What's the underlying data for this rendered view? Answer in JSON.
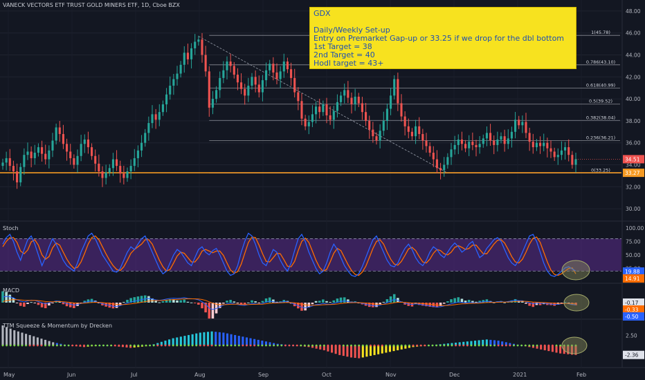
{
  "symbol_title": "VANECK VECTORS ETF TRUST GOLD MINERS ETF, 1D, Cboe BZX",
  "note": {
    "lines": [
      "GDX",
      "",
      "Daily/Weekly Set-up",
      "Entry on Premarket Gap-up or 33.25 if we drop for the dbl bottom",
      "1st Target = 38",
      "2nd Target = 40",
      "Hodl target = 43+"
    ]
  },
  "panels": {
    "stoch_title": "Stoch",
    "macd_title": "MACD",
    "ttm_title": "TTM Squeeze & Momentum by Drecken"
  },
  "colors": {
    "background": "#131722",
    "up": "#26a69a",
    "down": "#ef5350",
    "support_line": "#f59a23",
    "note_bg": "#f7e21f",
    "note_text": "#1d4fb3",
    "stoch_band": "#5b2b8c",
    "stoch_k": "#2962ff",
    "stoch_d": "#ff6d00",
    "fib_line": "#8a8d96"
  },
  "chart_data": [
    {
      "type": "candlestick",
      "title": "VANECK VECTORS ETF TRUST GOLD MINERS ETF, 1D, Cboe BZX",
      "x_labels": [
        "May",
        "Jun",
        "Jul",
        "Aug",
        "Sep",
        "Oct",
        "Nov",
        "Dec",
        "2021",
        "Feb"
      ],
      "y_ticks": [
        30.0,
        32.0,
        34.0,
        36.0,
        38.0,
        40.0,
        42.0,
        44.0,
        46.0,
        48.0
      ],
      "ylim": [
        29,
        49
      ],
      "closes": [
        34.2,
        34.6,
        33.9,
        33.4,
        32.4,
        33.8,
        34.9,
        35.2,
        34.6,
        35.1,
        35.6,
        35.0,
        34.5,
        35.3,
        36.2,
        37.4,
        36.8,
        35.9,
        35.2,
        34.6,
        34.0,
        34.8,
        35.9,
        36.3,
        35.6,
        34.8,
        34.1,
        33.4,
        32.8,
        33.3,
        33.7,
        34.5,
        33.9,
        33.2,
        32.8,
        33.4,
        33.9,
        34.6,
        35.3,
        36.0,
        36.9,
        37.8,
        38.6,
        38.1,
        38.8,
        39.5,
        40.4,
        41.2,
        41.8,
        42.3,
        43.1,
        44.2,
        43.6,
        44.6,
        45.2,
        45.4,
        44.0,
        42.5,
        39.2,
        40.0,
        40.8,
        41.9,
        42.6,
        43.4,
        43.0,
        42.2,
        41.5,
        40.9,
        40.3,
        41.2,
        42.0,
        41.3,
        40.6,
        41.7,
        42.6,
        43.2,
        42.4,
        41.8,
        42.5,
        43.4,
        42.7,
        41.9,
        40.6,
        39.8,
        38.2,
        37.5,
        37.9,
        38.6,
        39.3,
        38.8,
        39.5,
        38.5,
        38.1,
        38.9,
        39.7,
        40.3,
        40.8,
        40.1,
        39.5,
        40.2,
        39.6,
        38.8,
        38.0,
        37.2,
        36.6,
        36.2,
        37.1,
        38.0,
        39.1,
        40.3,
        41.8,
        39.6,
        38.4,
        37.5,
        37.0,
        36.6,
        37.5,
        36.8,
        36.2,
        35.7,
        35.1,
        34.5,
        33.7,
        33.5,
        34.0,
        34.7,
        35.4,
        35.8,
        36.3,
        35.9,
        35.5,
        36.1,
        35.8,
        35.6,
        35.9,
        36.4,
        36.9,
        36.2,
        35.8,
        36.3,
        36.6,
        35.9,
        36.4,
        37.0,
        38.1,
        37.6,
        37.9,
        36.9,
        36.1,
        35.6,
        36.0,
        35.7,
        36.0,
        35.5,
        35.2,
        34.7,
        34.9,
        35.3,
        35.6,
        34.9,
        34.0,
        34.51
      ],
      "support": 33.27,
      "last_price": 34.51,
      "trendline": {
        "from": 45.7,
        "to": 33.25
      },
      "fib_levels": [
        {
          "label": "1(45.78)",
          "value": 45.78
        },
        {
          "label": "0.786(43.10)",
          "value": 43.1
        },
        {
          "label": "0.618(40.99)",
          "value": 40.99
        },
        {
          "label": "0.5(39.52)",
          "value": 39.52
        },
        {
          "label": "0.382(38.04)",
          "value": 38.04
        },
        {
          "label": "0.236(36.21)",
          "value": 36.21
        },
        {
          "label": "0(33.25)",
          "value": 33.25
        }
      ],
      "badges": [
        {
          "label": "34.51",
          "value": 34.51,
          "color": "#ef5350"
        },
        {
          "label": "33.27",
          "value": 33.27,
          "color": "#f59a23"
        }
      ]
    },
    {
      "type": "line",
      "title": "Stoch",
      "y_ticks": [
        25.0,
        50.0,
        75.0,
        100.0
      ],
      "ylim": [
        0,
        110
      ],
      "band": [
        20,
        80
      ],
      "series": [
        {
          "name": "K",
          "values": [
            70,
            82,
            88,
            75,
            55,
            40,
            60,
            78,
            85,
            70,
            50,
            30,
            45,
            65,
            80,
            70,
            55,
            40,
            30,
            25,
            20,
            35,
            55,
            70,
            85,
            90,
            80,
            65,
            50,
            40,
            30,
            20,
            18,
            25,
            40,
            55,
            65,
            60,
            70,
            80,
            85,
            70,
            55,
            40,
            25,
            15,
            20,
            35,
            50,
            60,
            55,
            45,
            35,
            30,
            45,
            60,
            65,
            55,
            50,
            58,
            62,
            50,
            35,
            20,
            12,
            15,
            30,
            55,
            75,
            90,
            85,
            70,
            50,
            35,
            30,
            45,
            60,
            55,
            40,
            28,
            20,
            35,
            58,
            80,
            88,
            75,
            55,
            40,
            25,
            15,
            20,
            35,
            55,
            70,
            60,
            45,
            30,
            20,
            12,
            10,
            15,
            28,
            45,
            62,
            78,
            85,
            70,
            55,
            40,
            30,
            28,
            35,
            50,
            62,
            70,
            60,
            45,
            35,
            30,
            40,
            55,
            65,
            60,
            50,
            45,
            55,
            65,
            72,
            65,
            55,
            60,
            70,
            75,
            60,
            45,
            50,
            62,
            70,
            78,
            82,
            75,
            60,
            45,
            35,
            30,
            40,
            55,
            70,
            85,
            88,
            75,
            55,
            35,
            20,
            12,
            10,
            14,
            20,
            26,
            28,
            24,
            19.88
          ]
        },
        {
          "name": "D",
          "values": [
            65,
            75,
            82,
            82,
            73,
            57,
            52,
            59,
            74,
            78,
            68,
            50,
            42,
            47,
            63,
            72,
            68,
            55,
            42,
            32,
            25,
            27,
            37,
            53,
            70,
            82,
            85,
            78,
            65,
            52,
            40,
            30,
            23,
            21,
            28,
            40,
            53,
            60,
            65,
            70,
            78,
            78,
            70,
            55,
            40,
            28,
            20,
            23,
            35,
            48,
            55,
            53,
            45,
            37,
            37,
            45,
            57,
            60,
            57,
            54,
            57,
            57,
            49,
            35,
            22,
            16,
            19,
            33,
            53,
            73,
            83,
            82,
            68,
            52,
            38,
            37,
            45,
            53,
            52,
            41,
            29,
            28,
            38,
            58,
            75,
            81,
            73,
            57,
            40,
            27,
            20,
            23,
            37,
            53,
            62,
            58,
            45,
            32,
            21,
            14,
            12,
            18,
            29,
            45,
            62,
            75,
            78,
            70,
            55,
            42,
            33,
            31,
            38,
            49,
            61,
            64,
            58,
            47,
            37,
            35,
            42,
            53,
            60,
            58,
            52,
            50,
            55,
            64,
            67,
            64,
            60,
            62,
            68,
            68,
            60,
            52,
            52,
            61,
            70,
            77,
            78,
            72,
            60,
            47,
            37,
            35,
            42,
            55,
            70,
            81,
            83,
            73,
            55,
            37,
            22,
            14,
            12,
            15,
            20,
            25,
            26,
            14.91
          ]
        }
      ],
      "badges": [
        {
          "label": "19.88",
          "value": 19.88,
          "color": "#2962ff"
        },
        {
          "label": "14.91",
          "value": 14.91,
          "color": "#ff6d00"
        }
      ]
    },
    {
      "type": "bar",
      "title": "MACD",
      "ylim": [
        -1.2,
        1.2
      ],
      "values": [
        0.4,
        0.45,
        0.42,
        0.35,
        0.2,
        0.1,
        0.05,
        0.12,
        0.18,
        0.15,
        0.08,
        -0.02,
        -0.08,
        -0.02,
        0.06,
        0.12,
        0.1,
        0.02,
        -0.06,
        -0.12,
        -0.18,
        -0.14,
        -0.06,
        0.02,
        0.08,
        0.12,
        0.08,
        0.0,
        -0.08,
        -0.14,
        -0.2,
        -0.26,
        -0.28,
        -0.22,
        -0.12,
        -0.04,
        0.04,
        0.1,
        0.16,
        0.22,
        0.28,
        0.3,
        0.26,
        0.2,
        0.16,
        0.2,
        0.26,
        0.3,
        0.32,
        0.3,
        0.32,
        0.36,
        0.3,
        0.28,
        0.26,
        0.2,
        0.06,
        -0.12,
        -0.4,
        -0.5,
        -0.42,
        -0.3,
        -0.18,
        -0.08,
        -0.04,
        -0.08,
        -0.14,
        -0.18,
        -0.2,
        -0.14,
        -0.06,
        -0.08,
        -0.12,
        -0.06,
        0.04,
        0.1,
        0.06,
        0.0,
        0.02,
        0.08,
        0.06,
        -0.02,
        -0.12,
        -0.22,
        -0.34,
        -0.38,
        -0.32,
        -0.24,
        -0.14,
        -0.12,
        -0.06,
        -0.1,
        -0.12,
        -0.06,
        0.02,
        0.08,
        0.12,
        0.08,
        0.02,
        0.04,
        0.0,
        -0.06,
        -0.12,
        -0.18,
        -0.22,
        -0.24,
        -0.18,
        -0.1,
        0.0,
        0.12,
        0.24,
        0.16,
        0.06,
        -0.04,
        -0.1,
        -0.14,
        -0.08,
        -0.12,
        -0.16,
        -0.2,
        -0.24,
        -0.28,
        -0.32,
        -0.3,
        -0.24,
        -0.16,
        -0.08,
        -0.02,
        0.04,
        0.02,
        -0.02,
        0.02,
        0.0,
        -0.02,
        0.02,
        0.06,
        0.1,
        0.06,
        0.02,
        0.06,
        0.08,
        0.04,
        0.08,
        0.12,
        0.18,
        0.14,
        0.14,
        0.06,
        -0.02,
        -0.08,
        -0.04,
        -0.06,
        -0.04,
        -0.08,
        -0.1,
        -0.14,
        -0.12,
        -0.08,
        -0.04,
        -0.08,
        -0.14,
        -0.17
      ],
      "badges": [
        {
          "label": "-0.17",
          "value": -0.17,
          "color": "#e0e3eb"
        },
        {
          "label": "-0.33",
          "value": -0.33,
          "color": "#ff6d00"
        },
        {
          "label": "-0.50",
          "value": -0.5,
          "color": "#2962ff"
        }
      ]
    },
    {
      "type": "bar",
      "title": "TTM Squeeze & Momentum by Drecken",
      "y_ticks": [
        2.5,
        -2.5
      ],
      "ylim": [
        -4,
        6
      ],
      "values": [
        5.0,
        4.6,
        4.2,
        3.8,
        3.5,
        3.2,
        2.9,
        2.6,
        2.3,
        2.0,
        1.7,
        1.4,
        1.1,
        0.8,
        0.6,
        0.4,
        0.2,
        0.1,
        -0.1,
        -0.2,
        -0.3,
        -0.4,
        -0.3,
        -0.2,
        -0.1,
        0.0,
        0.1,
        0.0,
        -0.1,
        -0.2,
        -0.3,
        -0.4,
        -0.5,
        -0.6,
        -0.5,
        -0.4,
        -0.3,
        -0.2,
        0.1,
        0.3,
        0.6,
        0.9,
        1.2,
        1.5,
        1.8,
        2.0,
        2.2,
        2.4,
        2.6,
        2.8,
        3.0,
        3.2,
        3.3,
        3.4,
        3.5,
        3.4,
        3.3,
        3.2,
        3.0,
        2.8,
        2.6,
        2.4,
        2.2,
        2.0,
        1.8,
        1.6,
        1.4,
        1.2,
        1.0,
        0.8,
        0.6,
        0.4,
        0.3,
        0.2,
        0.1,
        0.0,
        -0.1,
        -0.2,
        -0.3,
        -0.4,
        -0.6,
        -0.8,
        -1.0,
        -1.2,
        -1.5,
        -1.8,
        -2.1,
        -2.4,
        -2.6,
        -2.8,
        -3.0,
        -3.1,
        -3.2,
        -3.0,
        -2.8,
        -2.6,
        -2.4,
        -2.2,
        -2.0,
        -1.8,
        -1.6,
        -1.4,
        -1.2,
        -1.0,
        -0.8,
        -0.6,
        -0.4,
        -0.3,
        -0.2,
        -0.1,
        0.0,
        0.1,
        0.2,
        0.3,
        0.4,
        0.5,
        0.6,
        0.7,
        0.8,
        0.9,
        1.0,
        1.1,
        1.2,
        1.3,
        1.4,
        1.5,
        1.4,
        1.3,
        1.2,
        1.0,
        0.8,
        0.6,
        0.4,
        0.2,
        0.0,
        -0.2,
        -0.4,
        -0.6,
        -0.8,
        -1.0,
        -1.2,
        -1.4,
        -1.6,
        -1.8,
        -2.0,
        -2.1,
        -2.2,
        -2.3,
        -2.36
      ],
      "badges": [
        {
          "label": "-2.36",
          "value": -2.36,
          "color": "#e0e3eb"
        }
      ]
    }
  ]
}
